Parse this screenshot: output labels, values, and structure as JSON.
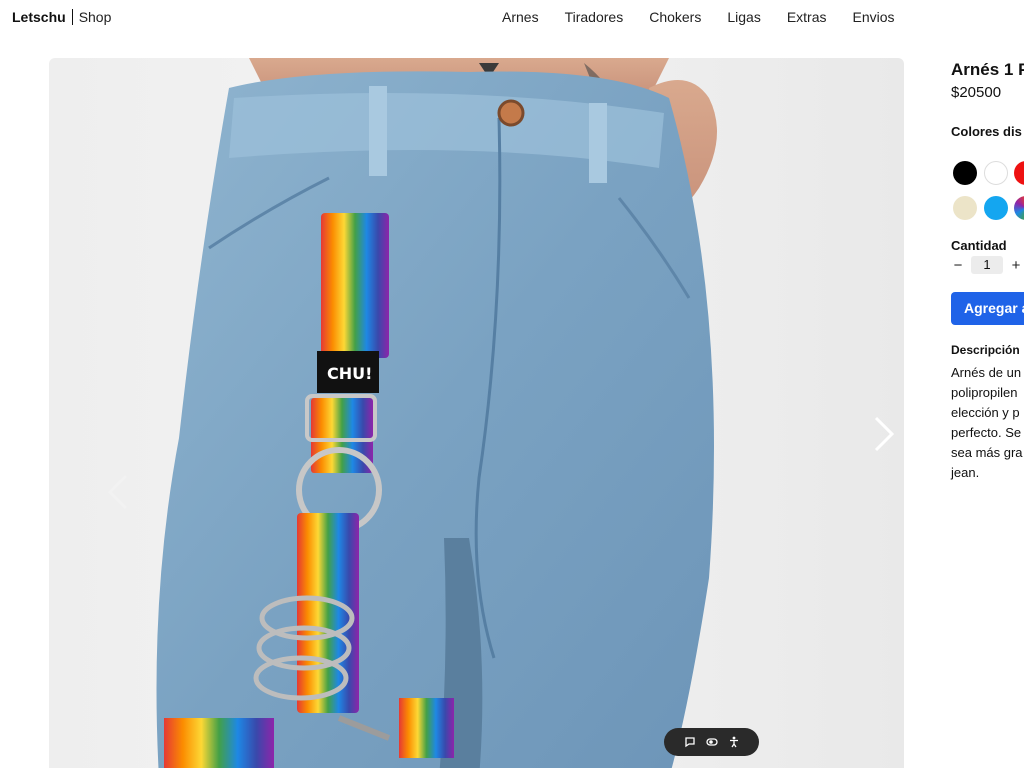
{
  "header": {
    "brand_name": "Letschu",
    "brand_section": "Shop",
    "nav": [
      "Arnes",
      "Tiradores",
      "Chokers",
      "Ligas",
      "Extras",
      "Envios"
    ]
  },
  "carousel": {
    "prev_icon": "chevron-left-icon",
    "next_icon": "chevron-right-icon",
    "photo_label": "CHU!"
  },
  "product": {
    "title": "Arnés 1 P",
    "price": "$20500",
    "colors_label": "Colores dis",
    "colors": [
      "#000000",
      "#ffffff",
      "#ee1111",
      "#ece4c8",
      "#14a6f0",
      "rainbow"
    ],
    "quantity_label": "Cantidad",
    "quantity_value": "1",
    "add_button": "Agregar a",
    "description_label": "Descripción",
    "description_lines": [
      "Arnés de un",
      "polipropilen",
      "elección y p",
      "perfecto. Se",
      "sea más gra",
      "jean."
    ]
  },
  "chat_widget": {
    "icons": [
      "chat-bubble-icon",
      "toggle-icon",
      "accessibility-icon"
    ]
  }
}
